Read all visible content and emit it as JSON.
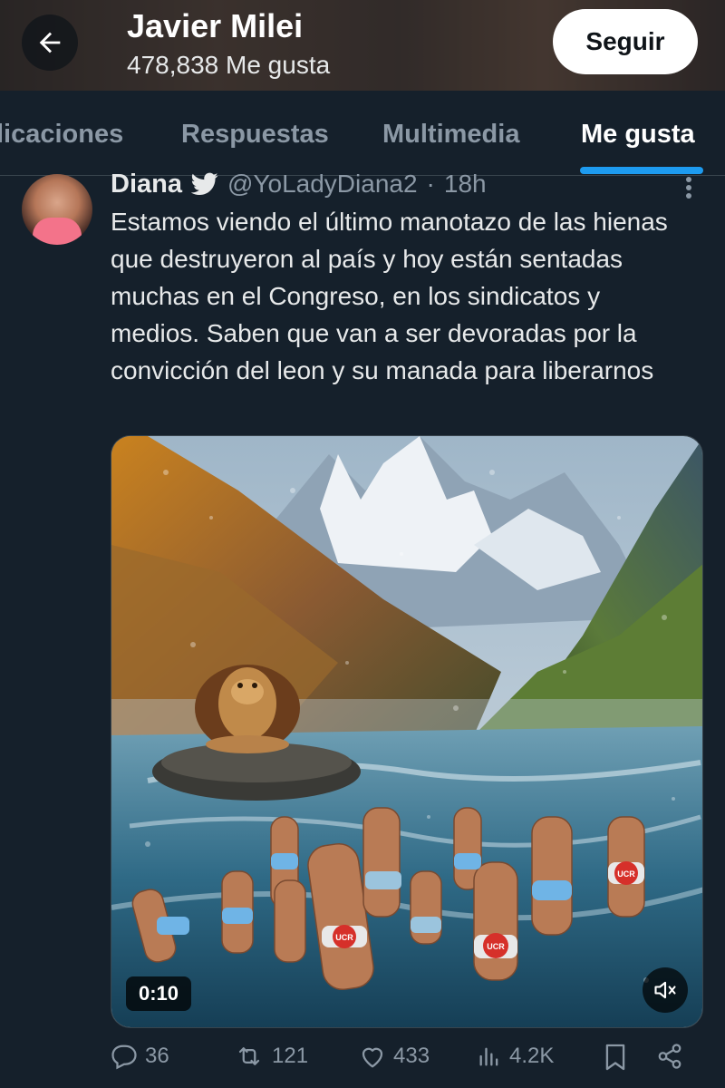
{
  "header": {
    "title": "Javier Milei",
    "likes_count": "478,838 Me gusta",
    "follow_label": "Seguir"
  },
  "tabs": [
    {
      "label": "Publicaciones",
      "visible_text": "licaciones",
      "active": false
    },
    {
      "label": "Respuestas",
      "active": false
    },
    {
      "label": "Multimedia",
      "active": false
    },
    {
      "label": "Me gusta",
      "active": true
    }
  ],
  "tweet": {
    "author_name": "Diana",
    "handle": "@YoLadyDiana2",
    "separator": "·",
    "time": "18h",
    "text": "Estamos viendo el último manotazo de las hienas que destruyeron al país y hoy están sentadas muchas en el Congreso, en los sindicatos y medios. Saben que van a ser devoradas por la convicción del leon y su manada para liberarnos",
    "media": {
      "duration": "0:10",
      "badge_texts": [
        "UCR",
        "UCR",
        "UCR"
      ]
    },
    "metrics": {
      "replies": "36",
      "retweets": "121",
      "likes": "433",
      "views": "4.2K"
    }
  },
  "colors": {
    "background": "#15202b",
    "accent": "#1d9bf0",
    "muted_text": "#8b98a5",
    "text": "#e7e9ea"
  }
}
